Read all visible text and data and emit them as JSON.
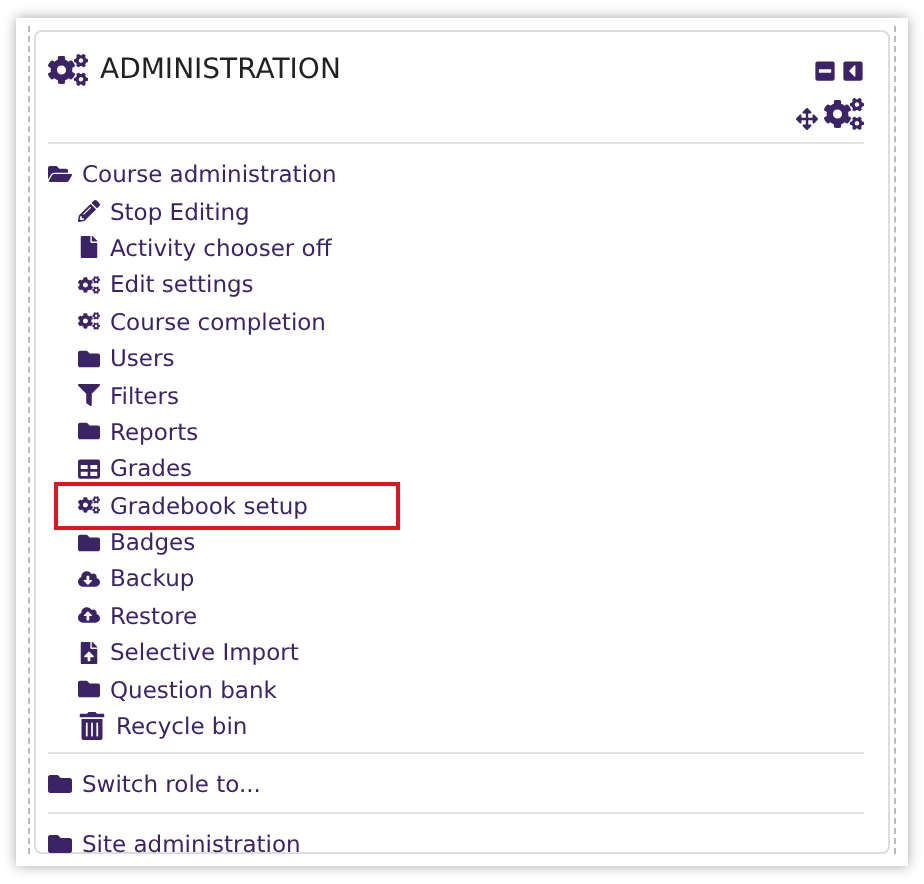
{
  "block": {
    "title": "ADMINISTRATION"
  },
  "course_admin": {
    "label": "Course administration",
    "expanded": true,
    "items": [
      {
        "label": "Stop Editing",
        "kind": "pencil",
        "highlighted": false
      },
      {
        "label": "Activity chooser off",
        "kind": "file",
        "highlighted": false
      },
      {
        "label": "Edit settings",
        "kind": "cogs",
        "highlighted": false
      },
      {
        "label": "Course completion",
        "kind": "cogs",
        "highlighted": false
      },
      {
        "label": "Users",
        "kind": "folder",
        "highlighted": false
      },
      {
        "label": "Filters",
        "kind": "filter",
        "highlighted": false
      },
      {
        "label": "Reports",
        "kind": "folder",
        "highlighted": false
      },
      {
        "label": "Grades",
        "kind": "table",
        "highlighted": false
      },
      {
        "label": "Gradebook setup",
        "kind": "cogs",
        "highlighted": true
      },
      {
        "label": "Badges",
        "kind": "folder",
        "highlighted": false
      },
      {
        "label": "Backup",
        "kind": "download",
        "highlighted": false
      },
      {
        "label": "Restore",
        "kind": "upload",
        "highlighted": false
      },
      {
        "label": "Selective Import",
        "kind": "import",
        "highlighted": false
      },
      {
        "label": "Question bank",
        "kind": "folder",
        "highlighted": false
      },
      {
        "label": "Recycle bin",
        "kind": "trash",
        "highlighted": false
      }
    ]
  },
  "sections": [
    {
      "label": "Switch role to...",
      "expanded": false
    },
    {
      "label": "Site administration",
      "expanded": false
    }
  ]
}
